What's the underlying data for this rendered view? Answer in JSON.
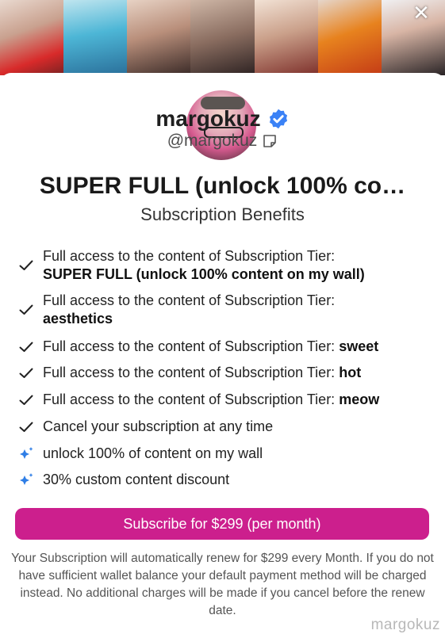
{
  "header": {
    "close_label": "✕"
  },
  "profile": {
    "username": "margokuz",
    "handle": "@margokuz",
    "verified_color": "#3b82f6"
  },
  "tier": {
    "title": "SUPER FULL (unlock 100% co…",
    "benefits_heading": "Subscription Benefits"
  },
  "benefits": [
    {
      "icon": "check-icon",
      "text": "Full access to the content of Subscription Tier:",
      "bold": "SUPER FULL (unlock 100% content on my wall)"
    },
    {
      "icon": "check-icon",
      "text": "Full access to the content of Subscription Tier:",
      "bold": "aesthetics"
    },
    {
      "icon": "check-icon",
      "text": "Full access to the content of Subscription Tier:",
      "bold": "sweet"
    },
    {
      "icon": "check-icon",
      "text": "Full access to the content of Subscription Tier:",
      "bold": "hot"
    },
    {
      "icon": "check-icon",
      "text": "Full access to the content of Subscription Tier:",
      "bold": "meow"
    },
    {
      "icon": "check-icon",
      "text": "Cancel your subscription at any time"
    },
    {
      "icon": "sparkle-star-icon",
      "text": "unlock 100% of content on my wall"
    },
    {
      "icon": "sparkle-star-icon",
      "text": "30% custom content discount"
    }
  ],
  "subscribe": {
    "label": "Subscribe for $299 (per month)",
    "color": "#cc1f8d"
  },
  "renew_note": "Your Subscription will automatically renew for $299 every Month. If you do not have sufficient wallet balance your default payment method will be charged instead. No additional charges will be made if you cancel before the renew date.",
  "watermark": "margokuz"
}
